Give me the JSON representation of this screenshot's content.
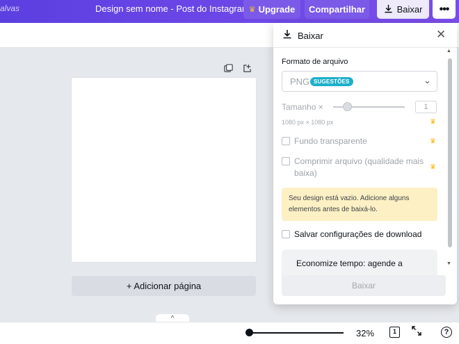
{
  "topbar": {
    "saved_text": "alvas",
    "doc_title": "Design sem nome - Post do Instagram",
    "upgrade_label": "Upgrade",
    "share_label": "Compartilhar",
    "download_label": "Baixar",
    "more_glyph": "•••"
  },
  "canvas": {
    "add_page_label": "+ Adicionar página"
  },
  "bottombar": {
    "zoom": "32%",
    "page_count": "1",
    "help_glyph": "?",
    "collapse_glyph": "^"
  },
  "panel": {
    "title": "Baixar",
    "format_label": "Formato de arquivo",
    "format_value": "PNG",
    "format_badge": "SUGESTÕES",
    "size_label": "Tamanho ×",
    "size_value": "1",
    "dimensions": "1080 px × 1080 px",
    "transparent_label": "Fundo transparente",
    "compress_label": "Comprimir arquivo (qualidade mais baixa)",
    "warning": "Seu design está vazio. Adicione alguns elementos antes de baixá-lo.",
    "save_settings_label": "Salvar configurações de download",
    "promo_text": "Economize tempo: agende a",
    "download_button": "Baixar"
  },
  "colors": {
    "topbar_gradient_start": "#5b3fe0",
    "topbar_gradient_end": "#7a4ee8",
    "badge": "#1eafc9",
    "warning_bg": "#fdf0c4",
    "crown": "#f5b80b"
  },
  "icons": {
    "crown": "crown-icon",
    "download": "download-icon",
    "close": "close-icon",
    "chevron": "chevron-down-icon",
    "duplicate": "duplicate-page-icon",
    "add_page": "add-page-icon",
    "fullscreen": "fullscreen-icon",
    "help": "help-icon"
  }
}
